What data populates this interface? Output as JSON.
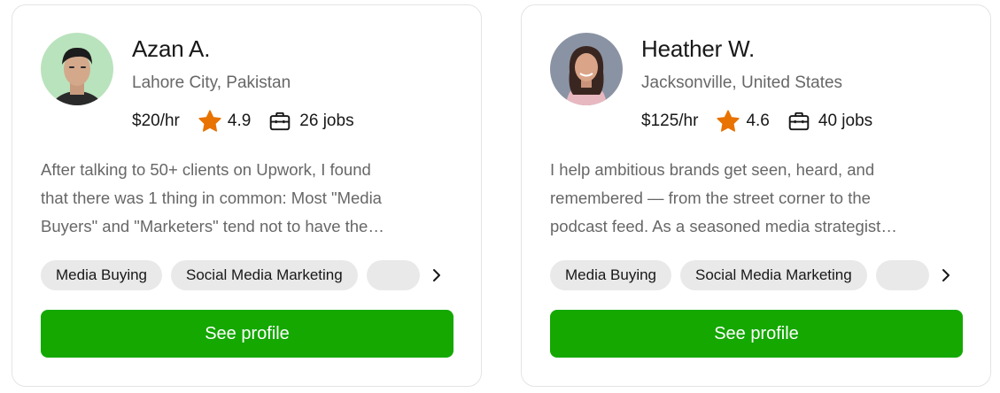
{
  "colors": {
    "accent": "#14a800",
    "star": "#e87300",
    "chip_bg": "#e9e9e9",
    "muted_text": "#676767"
  },
  "freelancers": [
    {
      "name": "Azan A.",
      "location": "Lahore City, Pakistan",
      "rate": "$20/hr",
      "rating": "4.9",
      "jobs": "26 jobs",
      "description_lines": [
        "After talking to 50+ clients on Upwork, I found",
        "that there was 1 thing in common: Most \"Media",
        "Buyers\" and \"Marketers\" tend not to have the…"
      ],
      "skills": [
        "Media Buying",
        "Social Media Marketing"
      ],
      "button_label": "See profile"
    },
    {
      "name": "Heather W.",
      "location": "Jacksonville, United States",
      "rate": "$125/hr",
      "rating": "4.6",
      "jobs": "40 jobs",
      "description_lines": [
        "I help ambitious brands get seen, heard, and",
        "remembered — from the street corner to the",
        "podcast feed. As a seasoned media strategist…"
      ],
      "skills": [
        "Media Buying",
        "Social Media Marketing"
      ],
      "button_label": "See profile"
    }
  ],
  "icons": {
    "star": "star-icon",
    "jobs": "briefcase-icon",
    "scroll": "chevron-right-icon"
  }
}
